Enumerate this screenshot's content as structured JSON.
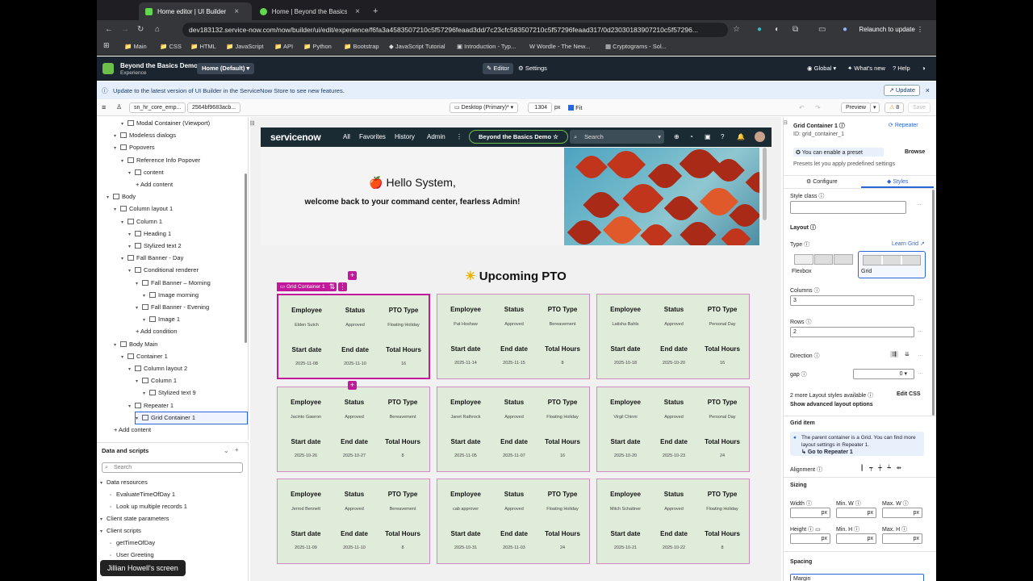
{
  "browser": {
    "tabs": [
      {
        "label": "Home editor | UI Builder",
        "active": true
      },
      {
        "label": "Home | Beyond the Basics De",
        "active": false
      }
    ],
    "url": "dev183132.service-now.com/now/builder/ui/edit/experience/f6fa3a4583507210c5f57296feaad3dd/7c23cfc583507210c5f57296feaad317/0d23030183907210c5f57296...",
    "relaunch": "Relaunch to update",
    "bookmarks": [
      "Main",
      "CSS",
      "HTML",
      "JavaScript",
      "API",
      "Python",
      "Bootstrap",
      "JavaScript Tutorial",
      "Introduction - Typ...",
      "Wordle - The New...",
      "Cryptograms - Sol..."
    ]
  },
  "app": {
    "title": "Beyond the Basics Demo",
    "subtitle": "Experience",
    "page": "Home (Default)",
    "editor": "Editor",
    "settings": "Settings",
    "global": "Global",
    "whats_new": "What's new",
    "help": "Help"
  },
  "notice": {
    "text": "Update to the latest version of UI Builder in the ServiceNow Store to see new features.",
    "button": "Update"
  },
  "toolbar": {
    "chip1": "sn_hr_core_emp...",
    "chip2": "2564bf9683acb...",
    "device": "Desktop (Primary)*",
    "width": "1304",
    "unit": "px",
    "fit": "Fit",
    "preview": "Preview",
    "warnings": "8",
    "save": "Save"
  },
  "tree": [
    {
      "label": "Modal Container (Viewport)",
      "indent": 2
    },
    {
      "label": "Modeless dialogs",
      "indent": 1
    },
    {
      "label": "Popovers",
      "indent": 1
    },
    {
      "label": "Reference Info Popover",
      "indent": 2
    },
    {
      "label": "content",
      "indent": 3
    },
    {
      "label": "+ Add content",
      "indent": 4
    },
    {
      "label": "Body",
      "indent": 0
    },
    {
      "label": "Column layout 1",
      "indent": 1
    },
    {
      "label": "Column 1",
      "indent": 2
    },
    {
      "label": "Heading 1",
      "indent": 3
    },
    {
      "label": "Stylized text 2",
      "indent": 3
    },
    {
      "label": "Fall Banner - Day",
      "indent": 2
    },
    {
      "label": "Conditional renderer",
      "indent": 3
    },
    {
      "label": "Fall Banner – Morning",
      "indent": 4
    },
    {
      "label": "Image morning",
      "indent": 5
    },
    {
      "label": "Fall Banner - Evening",
      "indent": 4
    },
    {
      "label": "Image 1",
      "indent": 5
    },
    {
      "label": "+ Add condition",
      "indent": 4
    },
    {
      "label": "Body Main",
      "indent": 1
    },
    {
      "label": "Container 1",
      "indent": 2
    },
    {
      "label": "Column layout 2",
      "indent": 3
    },
    {
      "label": "Column 1",
      "indent": 4
    },
    {
      "label": "Stylized text 9",
      "indent": 5
    },
    {
      "label": "Repeater 1",
      "indent": 3
    },
    {
      "label": "Grid Container 1",
      "indent": 4,
      "selected": true
    },
    {
      "label": "+ Add content",
      "indent": 1
    }
  ],
  "data_scripts": {
    "title": "Data and scripts",
    "search": "Search",
    "items": [
      {
        "label": "Data resources",
        "indent": 0
      },
      {
        "label": "EvaluateTimeOfDay 1",
        "indent": 1
      },
      {
        "label": "Look up multiple records 1",
        "indent": 1
      },
      {
        "label": "Client state parameters",
        "indent": 0
      },
      {
        "label": "Client scripts",
        "indent": 0
      },
      {
        "label": "getTimeOfDay",
        "indent": 1
      },
      {
        "label": "User Greeting",
        "indent": 1
      }
    ]
  },
  "screen_label": "Jillian Howell's screen",
  "site": {
    "logo": "servicenow",
    "nav": [
      "All",
      "Favorites",
      "History",
      "Admin"
    ],
    "demo": "Beyond the Basics Demo",
    "search": "Search",
    "hello": "🍎 Hello System,",
    "welcome": "welcome back to your command center, fearless Admin!",
    "pto_title": "Upcoming PTO",
    "grid_tag": "Grid Container 1",
    "headers": {
      "employee": "Employee",
      "status": "Status",
      "type": "PTO Type",
      "start": "Start date",
      "end": "End date",
      "hours": "Total Hours"
    },
    "cards": [
      {
        "employee": "Elden Sutch",
        "status": "Approved",
        "type": "Floating Holiday",
        "start": "2025-11-08",
        "end": "2025-11-10",
        "hours": "16"
      },
      {
        "employee": "Pat Hoshaw",
        "status": "Approved",
        "type": "Bereavement",
        "start": "2025-11-14",
        "end": "2025-11-15",
        "hours": "8"
      },
      {
        "employee": "Latisha Bahls",
        "status": "Approved",
        "type": "Personal Day",
        "start": "2025-10-18",
        "end": "2025-10-20",
        "hours": "16"
      },
      {
        "employee": "Jacinto Gawron",
        "status": "Approved",
        "type": "Bereavement",
        "start": "2025-10-26",
        "end": "2025-10-27",
        "hours": "8"
      },
      {
        "employee": "Janet Rathrock",
        "status": "Approved",
        "type": "Floating Holiday",
        "start": "2025-11-05",
        "end": "2025-11-07",
        "hours": "16"
      },
      {
        "employee": "Virgil Chinni",
        "status": "Approved",
        "type": "Personal Day",
        "start": "2025-10-20",
        "end": "2025-10-23",
        "hours": "24"
      },
      {
        "employee": "Jerrod Bennett",
        "status": "Approved",
        "type": "Bereavement",
        "start": "2025-11-09",
        "end": "2025-11-10",
        "hours": "8"
      },
      {
        "employee": "cab approver",
        "status": "Approved",
        "type": "Floating Holiday",
        "start": "2025-10-31",
        "end": "2025-11-03",
        "hours": "24"
      },
      {
        "employee": "Mitch Schattner",
        "status": "Approved",
        "type": "Floating Holiday",
        "start": "2025-10-21",
        "end": "2025-10-22",
        "hours": "8"
      }
    ]
  },
  "panel": {
    "title": "Grid Container 1",
    "repeater": "Repeater",
    "id": "ID: grid_container_1",
    "preset": "You can enable a preset",
    "browse": "Browse",
    "preset_desc": "Presets let you apply predefined settings",
    "tab_configure": "Configure",
    "tab_styles": "Styles",
    "style_class": "Style class",
    "layout": "Layout",
    "type": "Type",
    "learn_grid": "Learn Grid",
    "flexbox": "Flexbox",
    "grid": "Grid",
    "columns_label": "Columns",
    "columns": "3",
    "rows_label": "Rows",
    "rows": "2",
    "direction": "Direction",
    "gap": "gap",
    "gap_value": "0",
    "more_styles": "2 more Layout styles available",
    "edit_css": "Edit CSS",
    "advanced": "Show advanced layout options",
    "grid_item": "Grid item",
    "grid_note": "The parent container is a Grid. You can find more layout settings in Repeater 1.",
    "go_repeater": "Go to Repeater 1",
    "alignment": "Alignment",
    "sizing": "Sizing",
    "width": "Width",
    "min_w": "Min. W",
    "max_w": "Max. W",
    "height": "Height",
    "min_h": "Min. H",
    "max_h": "Max. H",
    "px": "px",
    "spacing": "Spacing",
    "margin": "Margin"
  }
}
